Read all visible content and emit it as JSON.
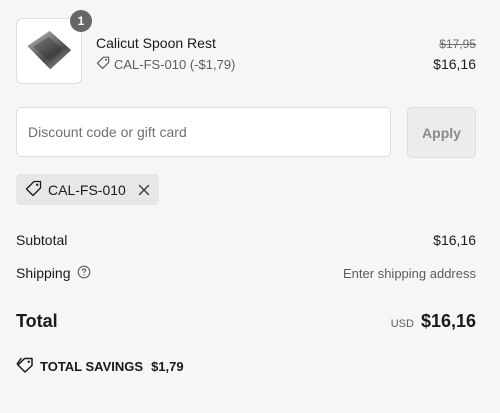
{
  "cart": {
    "items": [
      {
        "quantity": "1",
        "name": "Calicut Spoon Rest",
        "discount_code_label": "CAL-FS-010 (-$1,79)",
        "compare_price": "$17,95",
        "final_price": "$16,16",
        "image_icon": "product-photo"
      }
    ]
  },
  "discount": {
    "placeholder": "Discount code or gift card",
    "value": "",
    "apply_label": "Apply",
    "applied_code": "CAL-FS-010",
    "remove_icon": "close-icon",
    "tag_icon": "tag-icon"
  },
  "summary": {
    "subtotal_label": "Subtotal",
    "subtotal_value": "$16,16",
    "shipping_label": "Shipping",
    "shipping_help_icon": "question-circle-icon",
    "shipping_value": "Enter shipping address",
    "total_label": "Total",
    "currency": "USD",
    "total_value": "$16,16"
  },
  "savings": {
    "icon": "tag-icon",
    "label": "TOTAL SAVINGS",
    "value": "$1,79"
  },
  "colors": {
    "background": "#f6f6f6",
    "text": "#1a1a1a",
    "muted_text": "#5c5c5c",
    "border": "#dedede",
    "badge": "#666666",
    "chip": "#e7e7e7",
    "apply_disabled": "#ececec"
  }
}
